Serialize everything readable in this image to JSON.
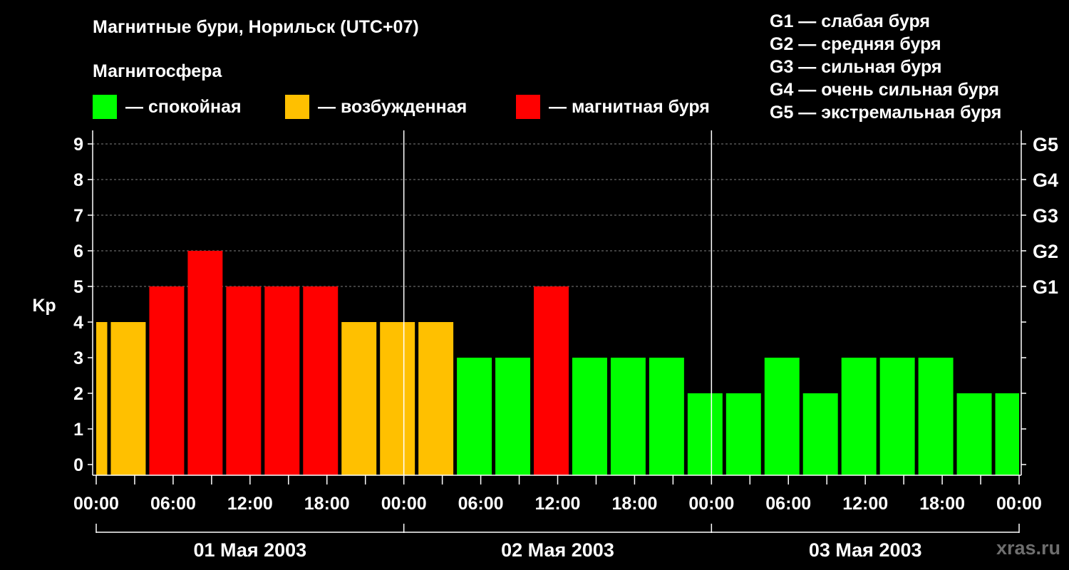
{
  "title": "Магнитные бури, Норильск (UTC+07)",
  "subtitle": "Магнитосфера",
  "legend": [
    {
      "label": "— спокойная",
      "color": "#00ff00"
    },
    {
      "label": "— возбужденная",
      "color": "#ffc000"
    },
    {
      "label": "— магнитная буря",
      "color": "#ff0000"
    }
  ],
  "g_legend": [
    "G1 — слабая буря",
    "G2 — средняя буря",
    "G3 — сильная буря",
    "G4 — очень сильная буря",
    "G5 — экстремальная буря"
  ],
  "watermark": "xras.ru",
  "colors": {
    "quiet": "#00ff00",
    "excited": "#ffc000",
    "storm": "#ff0000",
    "grid": "#808080"
  },
  "chart_data": {
    "type": "bar",
    "ylabel": "Kp",
    "ylim": [
      0,
      9
    ],
    "y_ticks": [
      "0",
      "1",
      "2",
      "3",
      "4",
      "5",
      "6",
      "7",
      "8",
      "9"
    ],
    "right_axis_labels": [
      {
        "kp": 5,
        "label": "G1"
      },
      {
        "kp": 6,
        "label": "G2"
      },
      {
        "kp": 7,
        "label": "G3"
      },
      {
        "kp": 8,
        "label": "G4"
      },
      {
        "kp": 9,
        "label": "G5"
      }
    ],
    "x_tick_labels": [
      "00:00",
      "06:00",
      "12:00",
      "18:00",
      "00:00",
      "06:00",
      "12:00",
      "18:00",
      "00:00",
      "06:00",
      "12:00",
      "18:00",
      "00:00"
    ],
    "days": [
      "01 Мая 2003",
      "02 Мая 2003",
      "03 Мая 2003"
    ],
    "bar_interval_hours": 3,
    "first_bar_start_hour": -2,
    "grid": true,
    "bars": [
      {
        "start": "01 Мая 2003 -02:00",
        "kp": 4,
        "status": "excited"
      },
      {
        "start": "01 Мая 2003 01:00",
        "kp": 4,
        "status": "excited"
      },
      {
        "start": "01 Мая 2003 04:00",
        "kp": 5,
        "status": "storm"
      },
      {
        "start": "01 Мая 2003 07:00",
        "kp": 6,
        "status": "storm"
      },
      {
        "start": "01 Мая 2003 10:00",
        "kp": 5,
        "status": "storm"
      },
      {
        "start": "01 Мая 2003 13:00",
        "kp": 5,
        "status": "storm"
      },
      {
        "start": "01 Мая 2003 16:00",
        "kp": 5,
        "status": "storm"
      },
      {
        "start": "01 Мая 2003 19:00",
        "kp": 4,
        "status": "excited"
      },
      {
        "start": "01 Мая 2003 22:00",
        "kp": 4,
        "status": "excited"
      },
      {
        "start": "02 Мая 2003 01:00",
        "kp": 4,
        "status": "excited"
      },
      {
        "start": "02 Мая 2003 04:00",
        "kp": 3,
        "status": "quiet"
      },
      {
        "start": "02 Мая 2003 07:00",
        "kp": 3,
        "status": "quiet"
      },
      {
        "start": "02 Мая 2003 10:00",
        "kp": 5,
        "status": "storm"
      },
      {
        "start": "02 Мая 2003 13:00",
        "kp": 3,
        "status": "quiet"
      },
      {
        "start": "02 Мая 2003 16:00",
        "kp": 3,
        "status": "quiet"
      },
      {
        "start": "02 Мая 2003 19:00",
        "kp": 3,
        "status": "quiet"
      },
      {
        "start": "02 Мая 2003 22:00",
        "kp": 2,
        "status": "quiet"
      },
      {
        "start": "03 Мая 2003 01:00",
        "kp": 2,
        "status": "quiet"
      },
      {
        "start": "03 Мая 2003 04:00",
        "kp": 3,
        "status": "quiet"
      },
      {
        "start": "03 Мая 2003 07:00",
        "kp": 2,
        "status": "quiet"
      },
      {
        "start": "03 Мая 2003 10:00",
        "kp": 3,
        "status": "quiet"
      },
      {
        "start": "03 Мая 2003 13:00",
        "kp": 3,
        "status": "quiet"
      },
      {
        "start": "03 Мая 2003 16:00",
        "kp": 3,
        "status": "quiet"
      },
      {
        "start": "03 Мая 2003 19:00",
        "kp": 2,
        "status": "quiet"
      },
      {
        "start": "03 Мая 2003 22:00",
        "kp": 2,
        "status": "quiet"
      }
    ]
  }
}
